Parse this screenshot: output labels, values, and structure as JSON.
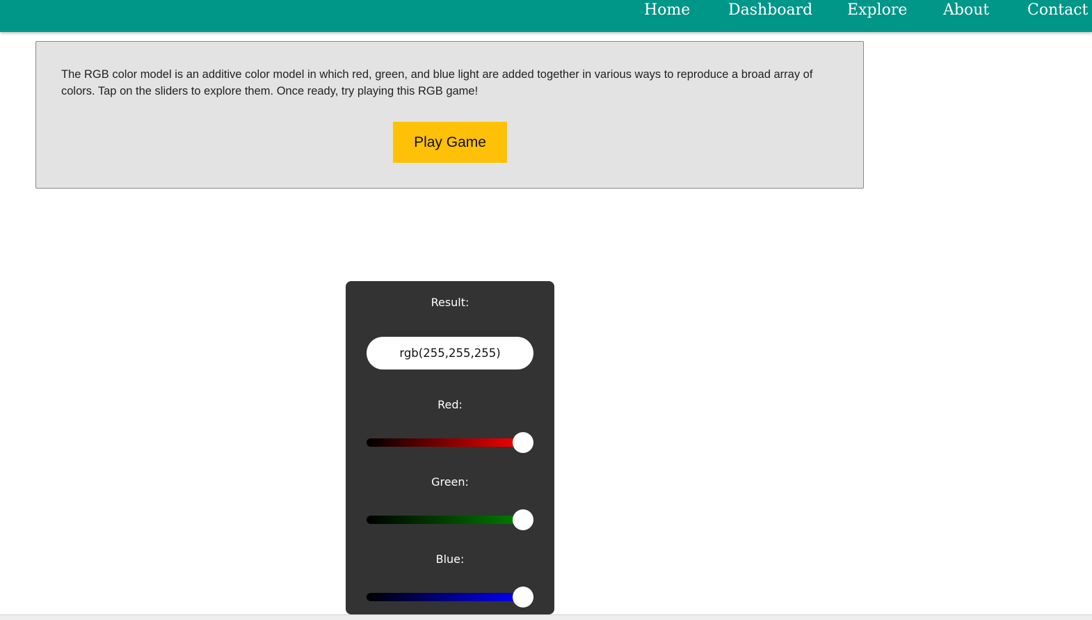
{
  "nav": {
    "items": [
      {
        "label": "Home"
      },
      {
        "label": "Dashboard"
      },
      {
        "label": "Explore"
      },
      {
        "label": "About"
      },
      {
        "label": "Contact"
      }
    ]
  },
  "intro": {
    "text": "The RGB color model is an additive color model in which red, green, and blue light are added together in various ways to reproduce a broad array of colors. Tap on the sliders to explore them. Once ready, try playing this RGB game!",
    "play_button_label": "Play Game"
  },
  "mixer": {
    "result_label": "Result:",
    "result_value": "rgb(255,255,255)",
    "sliders": [
      {
        "label": "Red:",
        "value": 255,
        "max": 255,
        "color": "#ff0000"
      },
      {
        "label": "Green:",
        "value": 255,
        "max": 255,
        "color": "#008000"
      },
      {
        "label": "Blue:",
        "value": 255,
        "max": 255,
        "color": "#0000ff"
      }
    ]
  },
  "colors": {
    "navbar": "#009688",
    "play_button": "#ffc107",
    "panel": "#333333",
    "info_box": "#e3e3e3"
  }
}
